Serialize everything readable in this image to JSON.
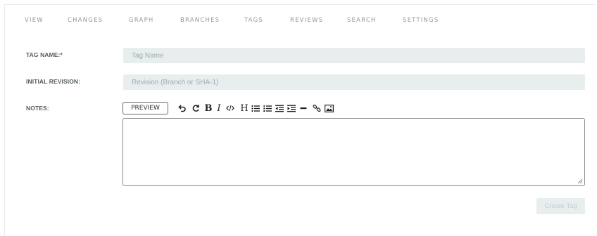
{
  "nav": {
    "tabs": [
      {
        "label": "VIEW"
      },
      {
        "label": "CHANGES"
      },
      {
        "label": "GRAPH"
      },
      {
        "label": "BRANCHES"
      },
      {
        "label": "TAGS"
      },
      {
        "label": "REVIEWS"
      },
      {
        "label": "SEARCH"
      },
      {
        "label": "SETTINGS"
      }
    ]
  },
  "form": {
    "tag_name": {
      "label": "TAG NAME:*",
      "placeholder": "Tag Name",
      "value": ""
    },
    "initial_revision": {
      "label": "INITIAL REVISION:",
      "placeholder": "Revision (Branch or SHA-1)",
      "value": ""
    },
    "notes": {
      "label": "NOTES:",
      "value": ""
    }
  },
  "editor": {
    "preview_label": "PREVIEW",
    "toolbar_icons": [
      "undo-icon",
      "redo-icon",
      "bold-icon",
      "italic-icon",
      "code-icon",
      "heading-icon",
      "bullet-list-icon",
      "numbered-list-icon",
      "outdent-icon",
      "indent-icon",
      "horizontal-rule-icon",
      "link-icon",
      "image-icon"
    ],
    "bold_glyph": "B",
    "italic_glyph": "I",
    "heading_glyph": "H"
  },
  "actions": {
    "create_label": "Create Tag"
  },
  "colors": {
    "tab_text": "#8f9aa2",
    "input_bg": "#e8eeee",
    "button_disabled_text": "#c6cdd1"
  }
}
